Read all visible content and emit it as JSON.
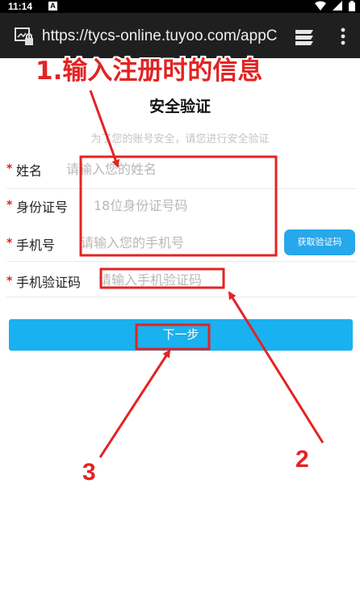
{
  "status_bar": {
    "time": "11:14",
    "notification_letter": "A",
    "icons": [
      "wifi-icon",
      "signal-icon",
      "battery-icon"
    ]
  },
  "browser": {
    "url": "https://tycs-online.tuyoo.com/appCa",
    "icons": [
      "site-info-icon",
      "tabs-icon",
      "overflow-menu-icon"
    ]
  },
  "page": {
    "title": "安全验证",
    "subtitle": "为了您的账号安全，请您进行安全验证",
    "required_mark": "*"
  },
  "form": {
    "fields": [
      {
        "label": "姓名",
        "placeholder": "请输入您的姓名",
        "value": ""
      },
      {
        "label": "身份证号",
        "placeholder": "18位身份证号码",
        "value": ""
      },
      {
        "label": "手机号",
        "placeholder": "请输入您的手机号",
        "value": ""
      },
      {
        "label": "手机验证码",
        "placeholder": "请输入手机验证码",
        "value": ""
      }
    ],
    "get_code_button": "获取验证码",
    "next_button": "下一步"
  },
  "annotations": {
    "caption": "1.输入注册时的信息",
    "step2": "2",
    "step3": "3",
    "color": "#e32323"
  },
  "colors": {
    "accent": "#1ab1f0",
    "required": "#e0201a",
    "toolbar": "#1f1f1f"
  }
}
